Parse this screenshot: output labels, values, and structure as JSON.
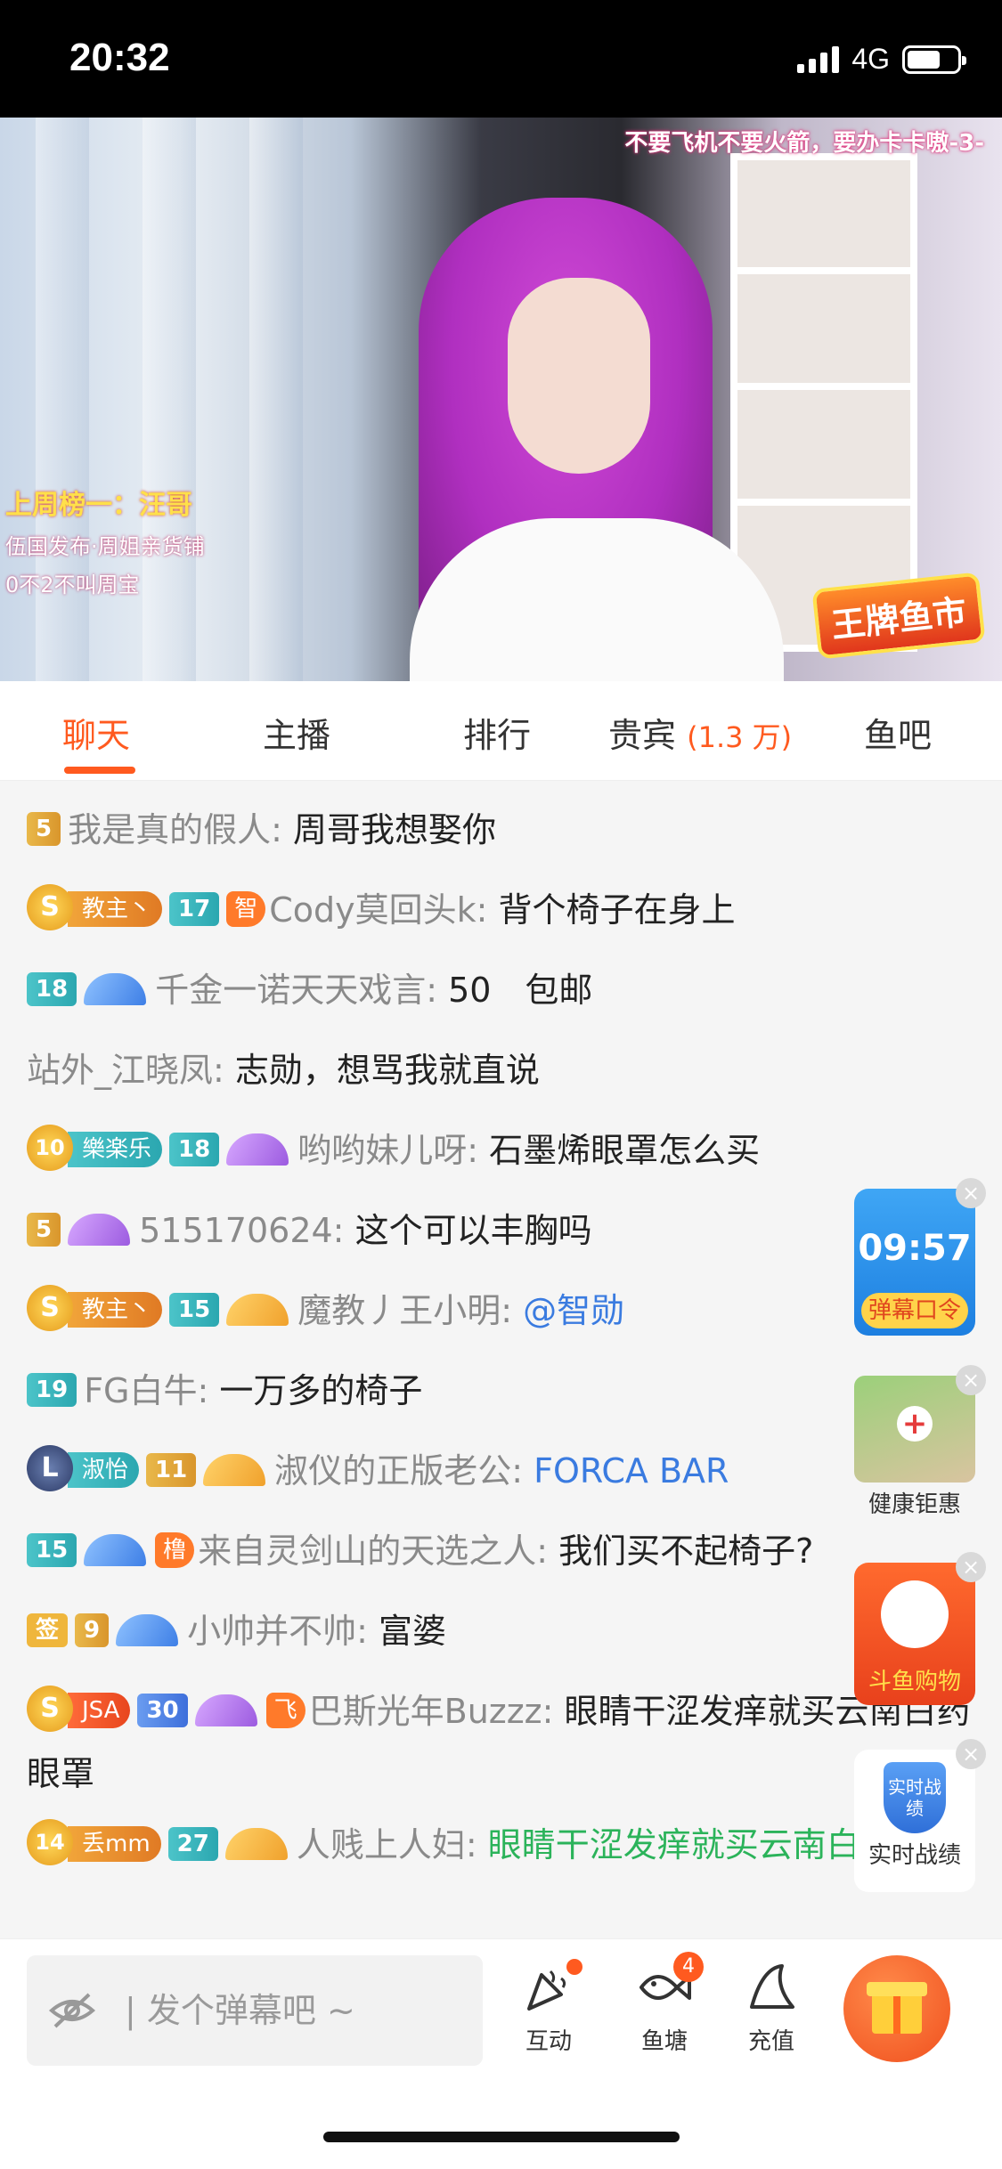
{
  "status": {
    "time": "20:32",
    "network": "4G"
  },
  "video": {
    "marquee": "不要飞机不要火箭，要办卡卡嗷-3-",
    "overlay_lines": [
      "上周榜一：汪哥",
      "伍国发布·周姐亲货铺",
      "0不2不叫周宝"
    ],
    "logo": "王牌鱼市"
  },
  "tabs": [
    {
      "label": "聊天"
    },
    {
      "label": "主播"
    },
    {
      "label": "排行"
    },
    {
      "label": "贵宾",
      "count": "(1.3 万)"
    },
    {
      "label": "鱼吧"
    }
  ],
  "messages": [
    {
      "badges": [
        "5"
      ],
      "name": "我是真的假人:",
      "text": " 周哥我想娶你"
    },
    {
      "fan": "教主丶",
      "crown": "S",
      "level": "17",
      "noble": "智",
      "name": "Cody莫回头k:",
      "text": " 背个椅子在身上"
    },
    {
      "level": "18",
      "wing": "blue",
      "name": "千金一诺天天戏言:",
      "text": " 50　包邮"
    },
    {
      "name": "站外_江晓凤:",
      "text": " 志勋，想骂我就直说"
    },
    {
      "fan": "樂楽乐",
      "crown": "10",
      "level": "18",
      "wing": "purple",
      "name": "哟哟妹儿呀:",
      "text": " 石墨烯眼罩怎么买"
    },
    {
      "badges": [
        "5"
      ],
      "wing": "purple",
      "name": "515170624:",
      "text": " 这个可以丰胸吗"
    },
    {
      "fan": "教主丶",
      "crown": "S",
      "level": "15",
      "wing": "gold",
      "name": "魔教丿王小明:",
      "text": " @智勋"
    },
    {
      "level": "19",
      "name": "FG白牛:",
      "text": " 一万多的椅子"
    },
    {
      "fan": "淑怡",
      "crown": "L",
      "level": "11",
      "wing": "gold",
      "name": "淑仪的正版老公:",
      "text": " FORCA BAR"
    },
    {
      "level": "15",
      "wing": "blue",
      "noble": "橹",
      "name": "来自灵剑山的天选之人:",
      "text": " 我们买不起椅子?"
    },
    {
      "sign": "签",
      "level": "9",
      "wing": "blue",
      "name": "小帅并不帅:",
      "text": " 富婆"
    },
    {
      "fan": "JSA",
      "crown": "S",
      "level": "30",
      "wing": "purple",
      "noble": "飞",
      "name": "巴斯光年Buzzz:",
      "text": " 眼睛干涩发痒就买云南白药眼罩"
    },
    {
      "fan": "丢mm",
      "crown": "14",
      "level": "27",
      "wing": "gold",
      "name": "人贱上人妇:",
      "text": " 眼睛干涩发痒就买云南白药眼罩"
    }
  ],
  "side_cards": {
    "timer": "09:57",
    "timer_label": "弹幕口令",
    "health_label": "健康钜惠",
    "shop_label": "斗鱼购物",
    "stats_icon": "实时战绩",
    "stats_label": "实时战绩"
  },
  "bottom": {
    "placeholder": "| 发个弹幕吧 ~",
    "actions": [
      "互动",
      "鱼塘",
      "充值"
    ],
    "fishpond_count": "4"
  }
}
